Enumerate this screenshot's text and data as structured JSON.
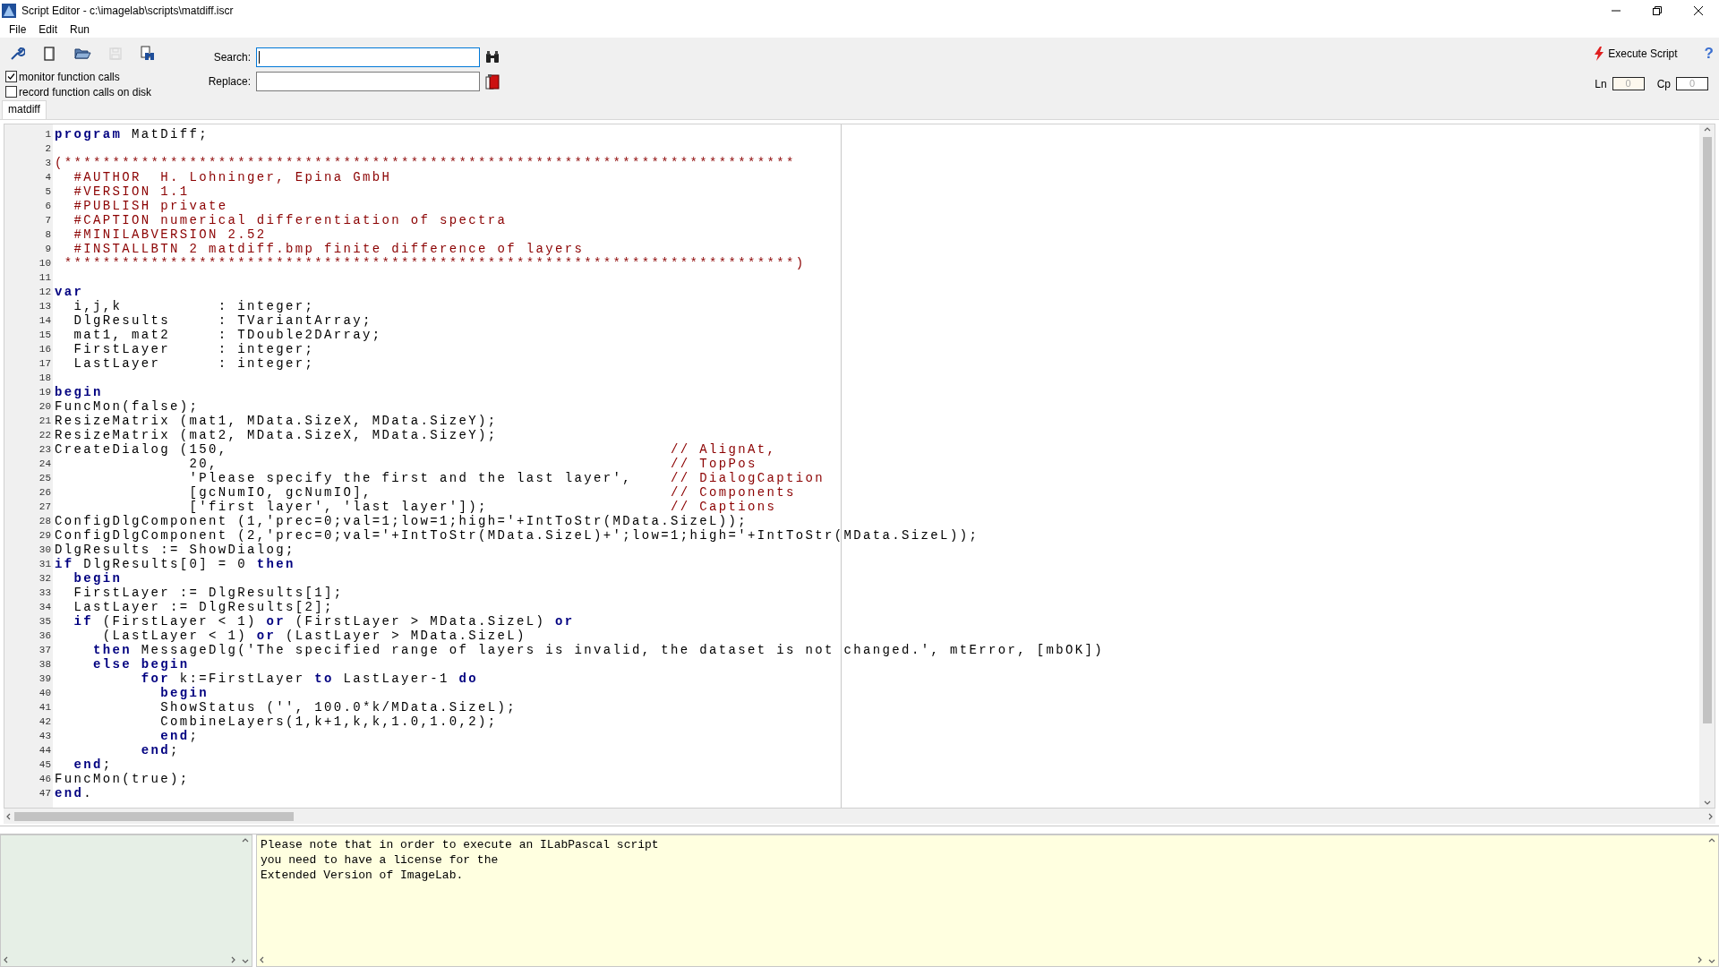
{
  "window": {
    "title": "Script Editor - c:\\imagelab\\scripts\\matdiff.iscr"
  },
  "menu": [
    {
      "label": "File"
    },
    {
      "label": "Edit"
    },
    {
      "label": "Run"
    }
  ],
  "toolbar_buttons": [
    {
      "kind": "wrench",
      "disabled": false
    },
    {
      "kind": "new",
      "disabled": false
    },
    {
      "kind": "open",
      "disabled": false
    },
    {
      "kind": "save",
      "disabled": true
    },
    {
      "kind": "find-doc",
      "disabled": false
    }
  ],
  "options": [
    {
      "label": "monitor function calls",
      "checked": true
    },
    {
      "label": "record function calls on disk",
      "checked": false
    }
  ],
  "search": {
    "label": "Search:",
    "focused": true
  },
  "replace": {
    "label": "Replace:",
    "focused": false
  },
  "execute_button": {
    "label": "Execute Script"
  },
  "help": "?",
  "position": {
    "ln_label": "Ln",
    "ln": "0",
    "cp_label": "Cp",
    "cp": "0"
  },
  "tabs": [
    {
      "label": "matdiff",
      "selected": true
    }
  ],
  "editor": {
    "lines": [
      {
        "n": "1",
        "segments": [
          {
            "kind": "kw",
            "text": "program"
          },
          {
            "kind": "code",
            "text": " MatDiff;"
          }
        ]
      },
      {
        "n": "2"
      },
      {
        "n": "3",
        "segments": [
          {
            "kind": "comment",
            "text": "(****************************************************************************"
          }
        ]
      },
      {
        "n": "4",
        "segments": [
          {
            "kind": "comment",
            "text": "  #AUTHOR  H. Lohninger, Epina GmbH"
          }
        ]
      },
      {
        "n": "5",
        "segments": [
          {
            "kind": "comment",
            "text": "  #VERSION 1.1"
          }
        ]
      },
      {
        "n": "6",
        "segments": [
          {
            "kind": "comment",
            "text": "  #PUBLISH private"
          }
        ]
      },
      {
        "n": "7",
        "segments": [
          {
            "kind": "comment",
            "text": "  #CAPTION numerical differentiation of spectra"
          }
        ]
      },
      {
        "n": "8",
        "segments": [
          {
            "kind": "comment",
            "text": "  #MINILABVERSION 2.52"
          }
        ]
      },
      {
        "n": "9",
        "segments": [
          {
            "kind": "comment",
            "text": "  #INSTALLBTN 2 matdiff.bmp finite difference of layers"
          }
        ]
      },
      {
        "n": "10",
        "segments": [
          {
            "kind": "comment",
            "text": " ****************************************************************************)"
          }
        ]
      },
      {
        "n": "11"
      },
      {
        "n": "12",
        "segments": [
          {
            "kind": "kw",
            "text": "var"
          }
        ]
      },
      {
        "n": "13",
        "segments": [
          {
            "kind": "code",
            "text": "  i,j,k          : integer;"
          }
        ]
      },
      {
        "n": "14",
        "segments": [
          {
            "kind": "code",
            "text": "  DlgResults     : TVariantArray;"
          }
        ]
      },
      {
        "n": "15",
        "segments": [
          {
            "kind": "code",
            "text": "  mat1, mat2     : TDouble2DArray;"
          }
        ]
      },
      {
        "n": "16",
        "segments": [
          {
            "kind": "code",
            "text": "  FirstLayer     : integer;"
          }
        ]
      },
      {
        "n": "17",
        "segments": [
          {
            "kind": "code",
            "text": "  LastLayer      : integer;"
          }
        ]
      },
      {
        "n": "18"
      },
      {
        "n": "19",
        "segments": [
          {
            "kind": "kw",
            "text": "begin"
          }
        ]
      },
      {
        "n": "20",
        "segments": [
          {
            "kind": "code",
            "text": "FuncMon(false);"
          }
        ]
      },
      {
        "n": "21",
        "segments": [
          {
            "kind": "code",
            "text": "ResizeMatrix (mat1, MData.SizeX, MData.SizeY);"
          }
        ]
      },
      {
        "n": "22",
        "segments": [
          {
            "kind": "code",
            "text": "ResizeMatrix (mat2, MData.SizeX, MData.SizeY);"
          }
        ]
      },
      {
        "n": "23",
        "segments": [
          {
            "kind": "code",
            "text": "CreateDialog (150,                                              "
          },
          {
            "kind": "comment",
            "text": "// AlignAt,"
          }
        ]
      },
      {
        "n": "24",
        "segments": [
          {
            "kind": "code",
            "text": "              20,                                               "
          },
          {
            "kind": "comment",
            "text": "// TopPos"
          }
        ]
      },
      {
        "n": "25",
        "segments": [
          {
            "kind": "code",
            "text": "              'Please specify the first and the last layer',    "
          },
          {
            "kind": "comment",
            "text": "// DialogCaption"
          }
        ]
      },
      {
        "n": "26",
        "segments": [
          {
            "kind": "code",
            "text": "              [gcNumIO, gcNumIO],                               "
          },
          {
            "kind": "comment",
            "text": "// Components"
          }
        ]
      },
      {
        "n": "27",
        "segments": [
          {
            "kind": "code",
            "text": "              ['first layer', 'last layer']);                   "
          },
          {
            "kind": "comment",
            "text": "// Captions"
          }
        ]
      },
      {
        "n": "28",
        "segments": [
          {
            "kind": "code",
            "text": "ConfigDlgComponent (1,'prec=0;val=1;low=1;high='+IntToStr(MData.SizeL));"
          }
        ]
      },
      {
        "n": "29",
        "segments": [
          {
            "kind": "code",
            "text": "ConfigDlgComponent (2,'prec=0;val='+IntToStr(MData.SizeL)+';low=1;high='+IntToStr(MData.SizeL));"
          }
        ]
      },
      {
        "n": "30",
        "segments": [
          {
            "kind": "code",
            "text": "DlgResults := ShowDialog;"
          }
        ]
      },
      {
        "n": "31",
        "segments": [
          {
            "kind": "kw",
            "text": "if"
          },
          {
            "kind": "code",
            "text": " DlgResults[0] = 0 "
          },
          {
            "kind": "kw",
            "text": "then"
          }
        ]
      },
      {
        "n": "32",
        "segments": [
          {
            "kind": "kw",
            "text": "  begin"
          }
        ]
      },
      {
        "n": "33",
        "segments": [
          {
            "kind": "code",
            "text": "  FirstLayer := DlgResults[1];"
          }
        ]
      },
      {
        "n": "34",
        "segments": [
          {
            "kind": "code",
            "text": "  LastLayer := DlgResults[2];"
          }
        ]
      },
      {
        "n": "35",
        "segments": [
          {
            "kind": "kw",
            "text": "  if"
          },
          {
            "kind": "code",
            "text": " (FirstLayer < 1) "
          },
          {
            "kind": "kw",
            "text": "or"
          },
          {
            "kind": "code",
            "text": " (FirstLayer > MData.SizeL) "
          },
          {
            "kind": "kw",
            "text": "or"
          }
        ]
      },
      {
        "n": "36",
        "segments": [
          {
            "kind": "code",
            "text": "     (LastLayer < 1) "
          },
          {
            "kind": "kw",
            "text": "or"
          },
          {
            "kind": "code",
            "text": " (LastLayer > MData.SizeL)"
          }
        ]
      },
      {
        "n": "37",
        "segments": [
          {
            "kind": "kw",
            "text": "    then"
          },
          {
            "kind": "code",
            "text": " MessageDlg('The specified range of layers is invalid, the dataset is not changed.', mtError, [mbOK])"
          }
        ]
      },
      {
        "n": "38",
        "segments": [
          {
            "kind": "kw",
            "text": "    else begin"
          }
        ]
      },
      {
        "n": "39",
        "segments": [
          {
            "kind": "kw",
            "text": "         for"
          },
          {
            "kind": "code",
            "text": " k:=FirstLayer "
          },
          {
            "kind": "kw",
            "text": "to"
          },
          {
            "kind": "code",
            "text": " LastLayer-1 "
          },
          {
            "kind": "kw",
            "text": "do"
          }
        ]
      },
      {
        "n": "40",
        "segments": [
          {
            "kind": "kw",
            "text": "           begin"
          }
        ]
      },
      {
        "n": "41",
        "segments": [
          {
            "kind": "code",
            "text": "           ShowStatus ('', 100.0*k/MData.SizeL);"
          }
        ]
      },
      {
        "n": "42",
        "segments": [
          {
            "kind": "code",
            "text": "           CombineLayers(1,k+1,k,k,1.0,1.0,2);"
          }
        ]
      },
      {
        "n": "43",
        "segments": [
          {
            "kind": "kw",
            "text": "           end"
          },
          {
            "kind": "code",
            "text": ";"
          }
        ]
      },
      {
        "n": "44",
        "segments": [
          {
            "kind": "kw",
            "text": "         end"
          },
          {
            "kind": "code",
            "text": ";"
          }
        ]
      },
      {
        "n": "45",
        "segments": [
          {
            "kind": "kw",
            "text": "  end"
          },
          {
            "kind": "code",
            "text": ";"
          }
        ]
      },
      {
        "n": "46",
        "segments": [
          {
            "kind": "code",
            "text": "FuncMon(true);"
          }
        ]
      },
      {
        "n": "47",
        "segments": [
          {
            "kind": "kw",
            "text": "end"
          },
          {
            "kind": "code",
            "text": "."
          }
        ]
      }
    ]
  },
  "messages": {
    "text": "Please note that in order to execute an ILabPascal script\nyou need to have a license for the\nExtended Version of ImageLab."
  }
}
